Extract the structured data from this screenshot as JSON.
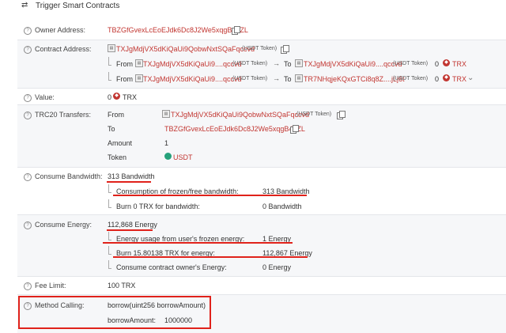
{
  "header": {
    "arrow_icon": "⇄",
    "title": "Trigger Smart Contracts"
  },
  "owner": {
    "label": "Owner Address:",
    "address": "TBZGfGvexLcEoEJdk6Dc8J2We5xqgB45ZL"
  },
  "contract": {
    "label": "Contract Address:",
    "address": "TXJgMdjVX5dKiQaUi9QobwNxtSQaFqccvd",
    "token_tag": "(USDT Token)",
    "transfers": [
      {
        "from_word": "From",
        "from": "TXJgMdjVX5dKiQaUi9....qccvd",
        "from_tag": "(USDT Token)",
        "to_word": "To",
        "to": "TXJgMdjVX5dKiQaUi9....qccvd",
        "to_tag": "(USDT Token)",
        "amount": "0",
        "unit": "TRX"
      },
      {
        "from_word": "From",
        "from": "TXJgMdjVX5dKiQaUi9....qccvd",
        "from_tag": "(USDT Token)",
        "to_word": "To",
        "to": "TR7NHqjeKQxGTCi8q8Z....jLj6t",
        "to_tag": "(USDT Token)",
        "amount": "0",
        "unit": "TRX"
      }
    ]
  },
  "value": {
    "label": "Value:",
    "amount": "0",
    "unit": "TRX"
  },
  "trc20": {
    "label": "TRC20 Transfers:",
    "from_label": "From",
    "from": "TXJgMdjVX5dKiQaUi9QobwNxtSQaFqccvd",
    "from_tag": "(USDT Token)",
    "to_label": "To",
    "to": "TBZGfGvexLcEoEJdk6Dc8J2We5xqgB45ZL",
    "amount_label": "Amount",
    "amount": "1",
    "token_label": "Token",
    "token": "USDT"
  },
  "bandwidth": {
    "label": "Consume Bandwidth:",
    "total": "313 Bandwidth",
    "rows": [
      {
        "name": "Consumption of frozen/free bandwidth:",
        "value": "313 Bandwidth"
      },
      {
        "name": "Burn 0 TRX for bandwidth:",
        "value": "0 Bandwidth"
      }
    ]
  },
  "energy": {
    "label": "Consume Energy:",
    "total": "112,868 Energy",
    "rows": [
      {
        "name": "Energy usage from user's frozen energy:",
        "value": "1 Energy"
      },
      {
        "name": "Burn 15.80138 TRX for energy:",
        "value": "112,867 Energy"
      },
      {
        "name": "Consume contract owner's Energy:",
        "value": "0 Energy"
      }
    ]
  },
  "fee": {
    "label": "Fee Limit:",
    "value": "100 TRX"
  },
  "method": {
    "label": "Method Calling:",
    "signature": "borrow(uint256 borrowAmount)",
    "param_name": "borrowAmount:",
    "param_value": "1000000"
  },
  "colors": {
    "accent_red": "#c23631",
    "highlight_red": "#e0221b",
    "usdt_green": "#26a17b"
  },
  "icons": [
    "swap-arrows-icon",
    "question-icon",
    "copy-icon",
    "contract-icon",
    "trx-coin-icon",
    "usdt-coin-icon",
    "chevron-down-icon"
  ]
}
